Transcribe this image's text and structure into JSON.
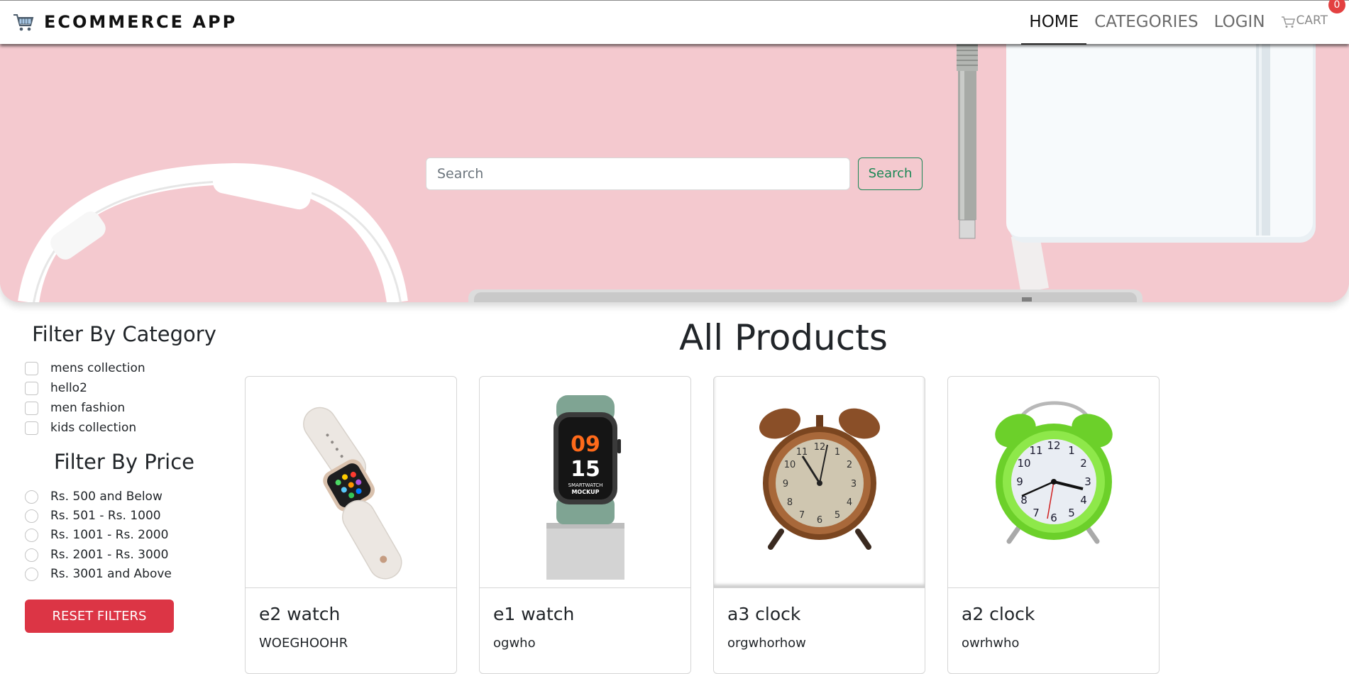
{
  "navbar": {
    "brand": "ECOMMERCE APP",
    "brand_icon": "shopping-cart-icon",
    "links": [
      {
        "label": "HOME",
        "active": true
      },
      {
        "label": "CATEGORIES",
        "active": false
      },
      {
        "label": "LOGIN",
        "active": false
      }
    ],
    "cart": {
      "label": "CART",
      "icon": "cart-icon",
      "count": "0"
    }
  },
  "hero": {
    "search": {
      "placeholder": "Search",
      "value": ""
    },
    "search_button": "Search",
    "background_color": "#f4c9cf"
  },
  "filters": {
    "category_title": "Filter By Category",
    "categories": [
      "mens collection",
      "hello2",
      "men fashion",
      "kids collection"
    ],
    "price_title": "Filter By Price",
    "prices": [
      "Rs. 500 and Below",
      "Rs. 501 - Rs. 1000",
      "Rs. 1001 - Rs. 2000",
      "Rs. 2001 - Rs. 3000",
      "Rs. 3001 and Above"
    ],
    "reset_label": "RESET FILTERS"
  },
  "products": {
    "title": "All Products",
    "items": [
      {
        "name": "e2 watch",
        "description": "WOEGHOOHR",
        "image": "watch-straps-image"
      },
      {
        "name": "e1 watch",
        "description": "ogwho",
        "image": "smartwatch-image"
      },
      {
        "name": "a3 clock",
        "description": "orgwhorhow",
        "image": "bronze-alarm-clock-image"
      },
      {
        "name": "a2 clock",
        "description": "owrhwho",
        "image": "green-alarm-clock-image"
      }
    ]
  },
  "colors": {
    "accent_green": "#198754",
    "danger_red": "#dc3545",
    "badge_red": "#e34040"
  }
}
